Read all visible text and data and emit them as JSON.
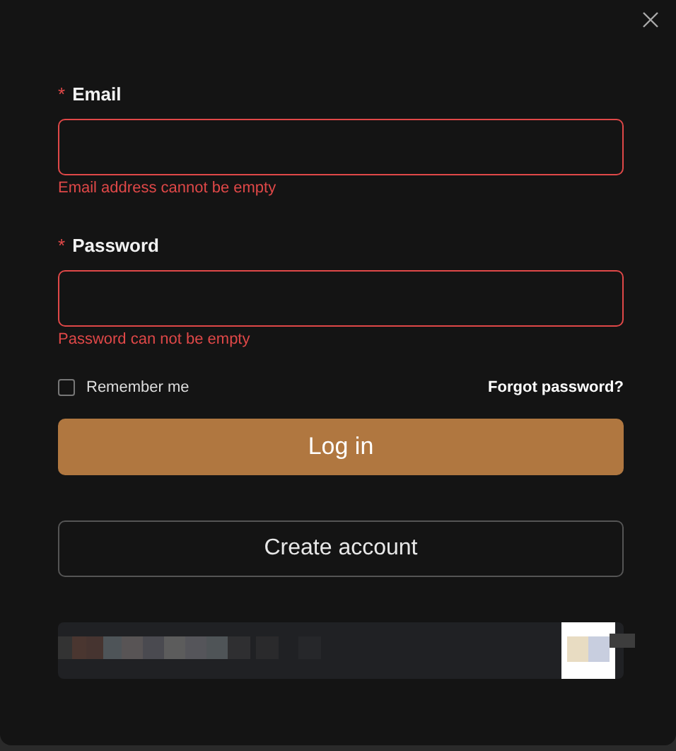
{
  "fields": [
    {
      "required_mark": "*",
      "label": "Email",
      "invalid": true,
      "error": "Email address cannot be empty"
    },
    {
      "required_mark": "*",
      "label": "Password",
      "invalid": true,
      "error": "Password can not be empty"
    }
  ],
  "remember": {
    "label": "Remember me",
    "checked": false
  },
  "forgot_link": "Forgot password?",
  "login_button": "Log in",
  "create_button": "Create account"
}
